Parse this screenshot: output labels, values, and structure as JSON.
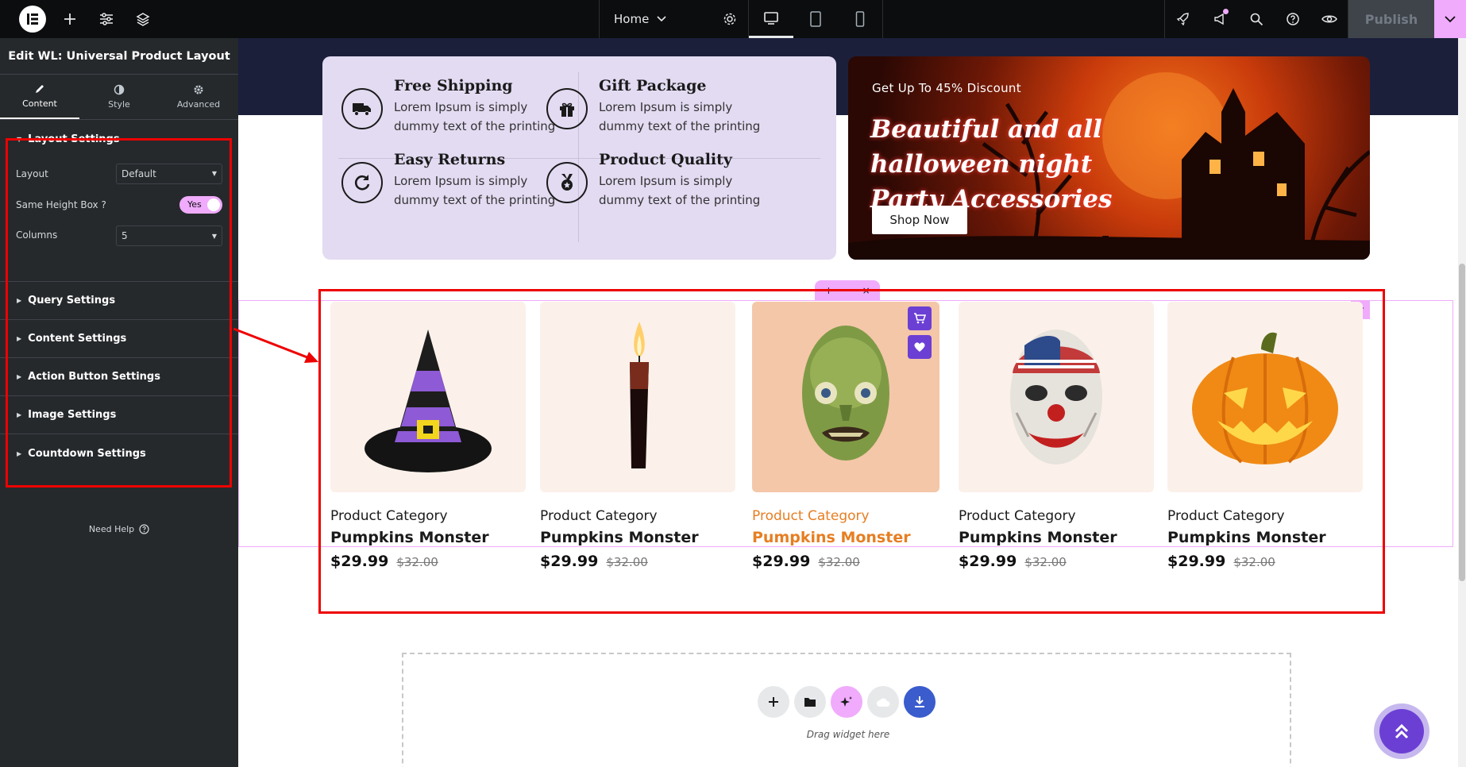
{
  "topbar": {
    "page_name": "Home",
    "publish_label": "Publish"
  },
  "sidebar": {
    "title": "Edit WL: Universal Product Layout",
    "tabs": [
      {
        "label": "Content",
        "icon": "pencil-icon",
        "active": true
      },
      {
        "label": "Style",
        "icon": "half-circle-icon",
        "active": false
      },
      {
        "label": "Advanced",
        "icon": "gear-icon",
        "active": false
      }
    ],
    "layout_section": {
      "label": "Layout Settings",
      "fields": {
        "layout_label": "Layout",
        "layout_value": "Default",
        "same_height_label": "Same Height Box ?",
        "same_height_value": "Yes",
        "columns_label": "Columns",
        "columns_value": "5"
      }
    },
    "sections": [
      "Query Settings",
      "Content Settings",
      "Action Button Settings",
      "Image Settings",
      "Countdown Settings"
    ],
    "help_label": "Need Help"
  },
  "canvas": {
    "features": [
      {
        "title": "Free Shipping",
        "desc": "Lorem Ipsum is simply dummy text of the printing",
        "icon": "truck-icon"
      },
      {
        "title": "Gift Package",
        "desc": "Lorem Ipsum is simply dummy text of the printing",
        "icon": "gift-icon"
      },
      {
        "title": "Easy Returns",
        "desc": "Lorem Ipsum is simply dummy text of the printing",
        "icon": "return-icon"
      },
      {
        "title": "Product Quality",
        "desc": "Lorem Ipsum is simply dummy text of the printing",
        "icon": "badge-icon"
      }
    ],
    "promo": {
      "tag": "Get Up To 45% Discount",
      "title": "Beautiful and all halloween night Party Accessories",
      "button": "Shop Now"
    },
    "products": [
      {
        "category": "Product Category",
        "name": "Pumpkins Monster",
        "price": "$29.99",
        "old_price": "$32.00",
        "image": "witch-hat"
      },
      {
        "category": "Product Category",
        "name": "Pumpkins Monster",
        "price": "$29.99",
        "old_price": "$32.00",
        "image": "candle"
      },
      {
        "category": "Product Category",
        "name": "Pumpkins Monster",
        "price": "$29.99",
        "old_price": "$32.00",
        "image": "zombie-mask",
        "highlighted": true
      },
      {
        "category": "Product Category",
        "name": "Pumpkins Monster",
        "price": "$29.99",
        "old_price": "$32.00",
        "image": "clown-mask"
      },
      {
        "category": "Product Category",
        "name": "Pumpkins Monster",
        "price": "$29.99",
        "old_price": "$32.00",
        "image": "jack-o-lantern"
      }
    ],
    "dropzone_label": "Drag widget here"
  },
  "colors": {
    "accent_pink": "#f0abfc",
    "annotation_red": "#ee0000",
    "product_purple": "#6b3fd4",
    "highlight_orange": "#e67e22"
  }
}
